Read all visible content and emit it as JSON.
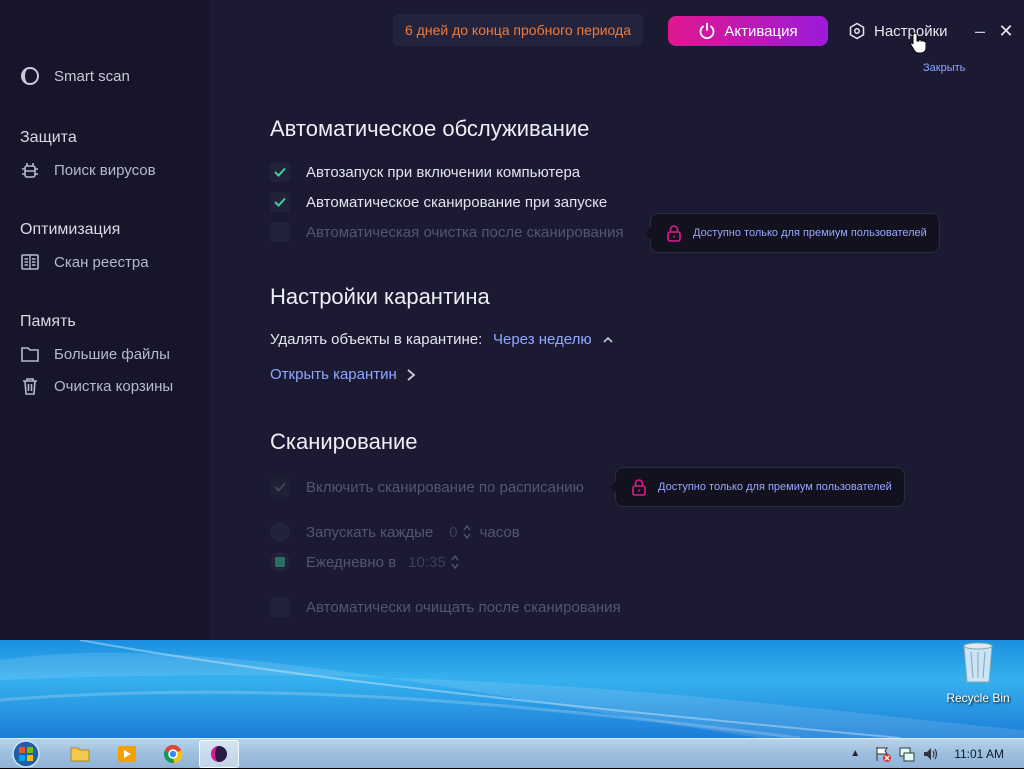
{
  "window": {
    "trial_text": "6 дней до конца пробного периода",
    "activate_label": "Активация",
    "settings_label": "Настройки",
    "close_tooltip": "Закрыть"
  },
  "sidebar": {
    "smart_scan": "Smart scan",
    "sections": [
      {
        "title": "Защита",
        "items": [
          {
            "label": "Поиск вирусов",
            "icon": "bug-icon"
          }
        ]
      },
      {
        "title": "Оптимизация",
        "items": [
          {
            "label": "Скан реестра",
            "icon": "registry-icon"
          }
        ]
      },
      {
        "title": "Память",
        "items": [
          {
            "label": "Большие файлы",
            "icon": "folder-icon"
          },
          {
            "label": "Очистка корзины",
            "icon": "trash-icon"
          }
        ]
      }
    ]
  },
  "maintenance": {
    "title": "Автоматическое обслуживание",
    "items": [
      {
        "label": "Автозапуск при включении компьютера",
        "checked": true,
        "disabled": false
      },
      {
        "label": "Автоматическое сканирование при запуске",
        "checked": true,
        "disabled": false
      },
      {
        "label": "Автоматическая очистка после сканирования",
        "checked": false,
        "disabled": true
      }
    ],
    "premium_note": "Доступно только для премиум пользователей"
  },
  "quarantine": {
    "title": "Настройки карантина",
    "delete_label": "Удалять объекты в карантине:",
    "delete_value": "Через неделю",
    "open_label": "Открыть карантин"
  },
  "scan": {
    "title": "Сканирование",
    "schedule_label": "Включить сканирование по расписанию",
    "premium_note": "Доступно только для премиум пользователей",
    "every_label": "Запускать каждые",
    "every_value": "0",
    "every_unit": "часов",
    "daily_label": "Ежедневно в",
    "daily_time": "10:35",
    "auto_clean_label": "Автоматически очищать после сканирования"
  },
  "desktop": {
    "recycle_bin": "Recycle Bin"
  },
  "taskbar": {
    "apps": [
      "explorer-icon",
      "media-player-icon",
      "chrome-icon",
      "antivirus-app-icon"
    ],
    "clock": "11:01 AM"
  },
  "colors": {
    "accent": "#8ea8ff",
    "activate_from": "#e0188f",
    "activate_to": "#9b1ad9",
    "trial_text": "#f07c3b",
    "check": "#3fd0a0"
  }
}
